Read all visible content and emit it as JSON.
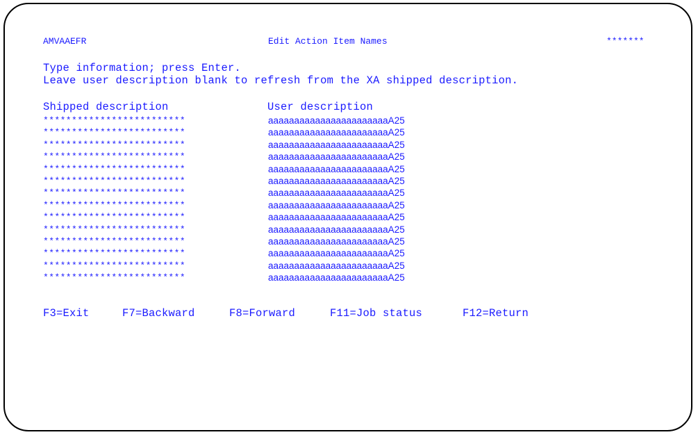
{
  "screen": {
    "program_id": "AMVAAEFR",
    "title": "Edit Action Item Names",
    "system_mask": "*******"
  },
  "instructions": {
    "line1": "Type information; press Enter.",
    "line2": "Leave user description blank to refresh from the XA shipped description."
  },
  "columns": {
    "shipped": "Shipped description",
    "user": "User description"
  },
  "rows": [
    {
      "shipped": "*************************",
      "user": "aaaaaaaaaaaaaaaaaaaaaaaA25"
    },
    {
      "shipped": "*************************",
      "user": "aaaaaaaaaaaaaaaaaaaaaaaA25"
    },
    {
      "shipped": "*************************",
      "user": "aaaaaaaaaaaaaaaaaaaaaaaA25"
    },
    {
      "shipped": "*************************",
      "user": "aaaaaaaaaaaaaaaaaaaaaaaA25"
    },
    {
      "shipped": "*************************",
      "user": "aaaaaaaaaaaaaaaaaaaaaaaA25"
    },
    {
      "shipped": "*************************",
      "user": "aaaaaaaaaaaaaaaaaaaaaaaA25"
    },
    {
      "shipped": "*************************",
      "user": "aaaaaaaaaaaaaaaaaaaaaaaA25"
    },
    {
      "shipped": "*************************",
      "user": "aaaaaaaaaaaaaaaaaaaaaaaA25"
    },
    {
      "shipped": "*************************",
      "user": "aaaaaaaaaaaaaaaaaaaaaaaA25"
    },
    {
      "shipped": "*************************",
      "user": "aaaaaaaaaaaaaaaaaaaaaaaA25"
    },
    {
      "shipped": "*************************",
      "user": "aaaaaaaaaaaaaaaaaaaaaaaA25"
    },
    {
      "shipped": "*************************",
      "user": "aaaaaaaaaaaaaaaaaaaaaaaA25"
    },
    {
      "shipped": "*************************",
      "user": "aaaaaaaaaaaaaaaaaaaaaaaA25"
    },
    {
      "shipped": "*************************",
      "user": "aaaaaaaaaaaaaaaaaaaaaaaA25"
    }
  ],
  "function_keys": [
    {
      "label": "F3=Exit"
    },
    {
      "label": "F7=Backward"
    },
    {
      "label": "F8=Forward"
    },
    {
      "label": "F11=Job status"
    },
    {
      "label": "F12=Return"
    }
  ],
  "colors": {
    "text": "#1a1aff",
    "border": "#000000",
    "background": "#ffffff"
  }
}
